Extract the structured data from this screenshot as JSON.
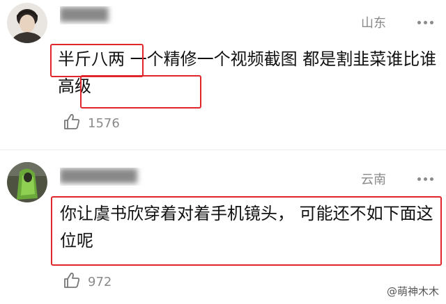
{
  "comments": [
    {
      "username_blurred": "█████",
      "location": "山东",
      "text": "半斤八两 一个精修一个视频截图 都是割韭菜谁比谁高级",
      "likes": "1576"
    },
    {
      "username_blurred": "████████",
      "location": "云南",
      "text": "你让虞书欣穿着对着手机镜头， 可能还不如下面这位呢",
      "likes": "972"
    }
  ],
  "watermark": {
    "text": "@萌神木木"
  },
  "icons": {
    "like": "thumbs-up-icon",
    "more": "more-dots-icon"
  },
  "colors": {
    "highlight": "#e0262a",
    "meta": "#8a8a8a"
  }
}
